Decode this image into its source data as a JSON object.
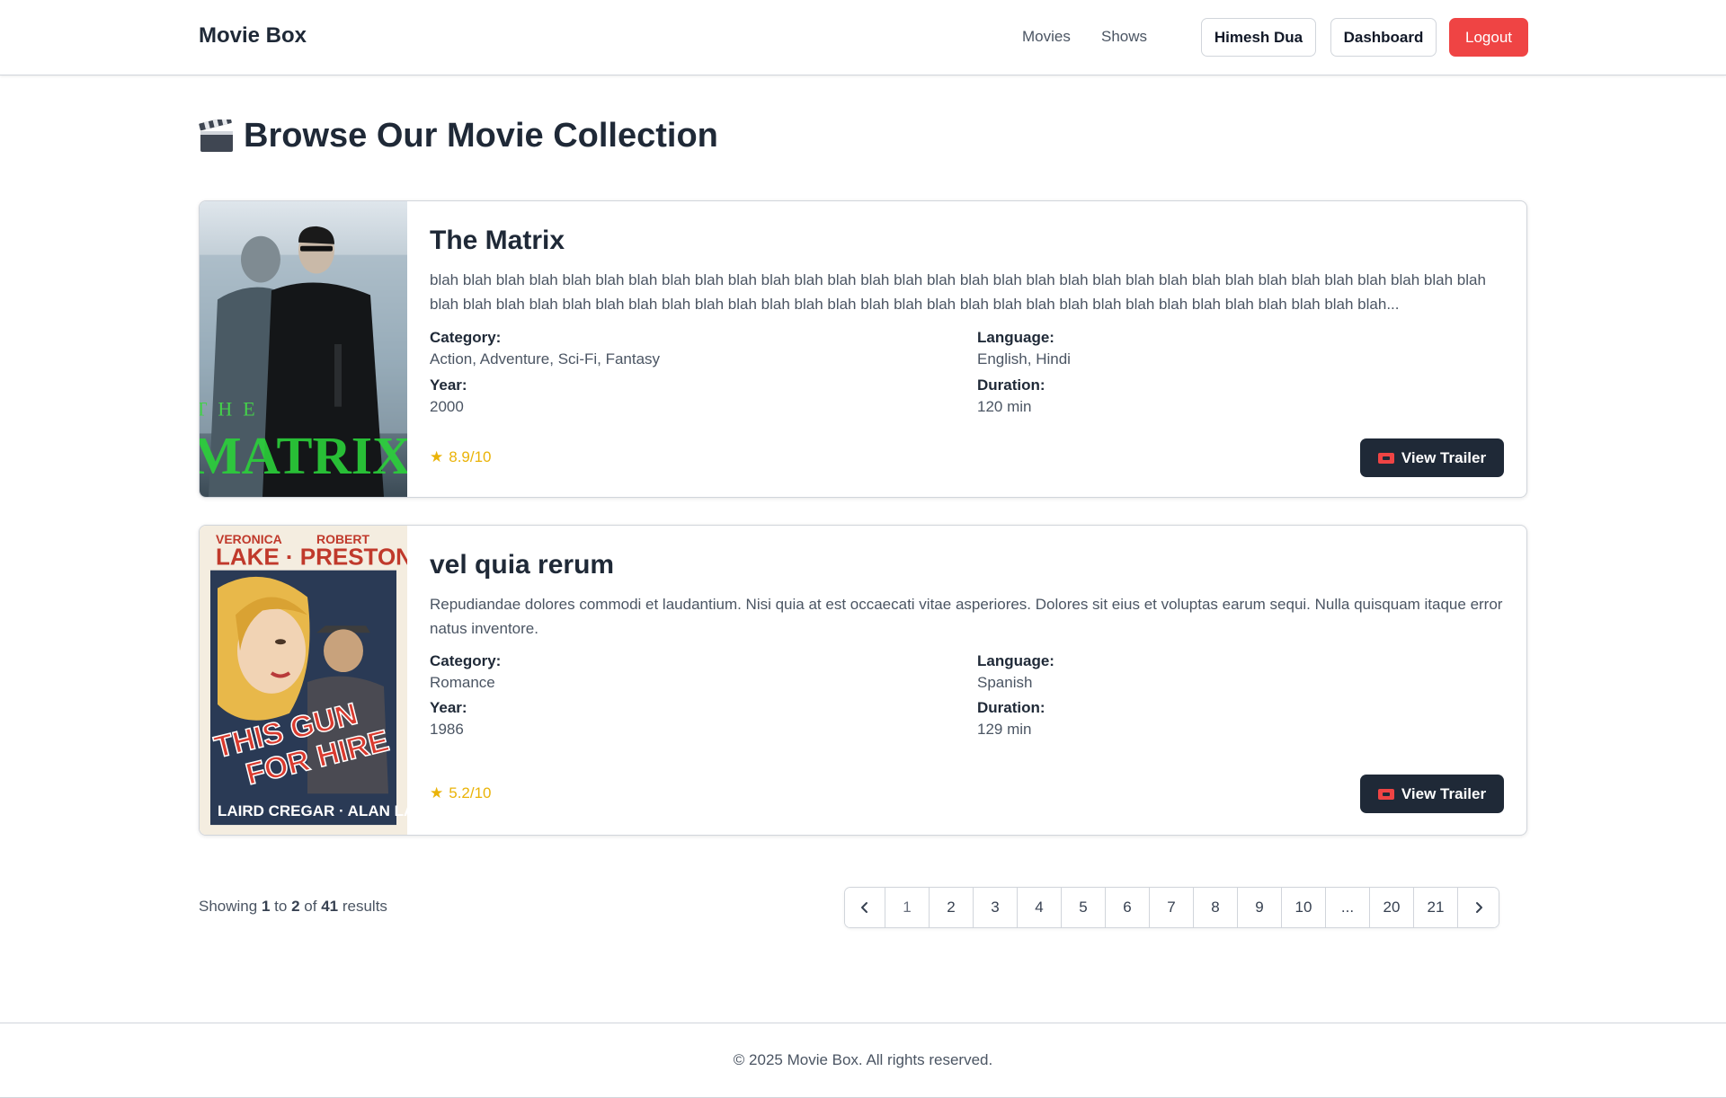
{
  "header": {
    "brand": "Movie Box",
    "nav": [
      "Movies",
      "Shows"
    ],
    "user_label": "Himesh Dua",
    "dashboard_label": "Dashboard",
    "logout_label": "Logout",
    "accent_color": "#ef4444"
  },
  "page": {
    "title": "Browse Our Movie Collection",
    "title_icon": "clapperboard-icon"
  },
  "movies": [
    {
      "title": "The Matrix",
      "description": "blah blah blah blah blah blah blah blah blah blah blah blah blah blah blah blah blah blah blah blah blah blah blah blah blah blah blah blah blah blah blah blah blah blah blah blah blah blah blah blah blah blah blah blah blah blah blah blah blah blah blah blah blah blah blah blah blah blah blah blah blah...",
      "category_label": "Category:",
      "category": "Action, Adventure, Sci-Fi, Fantasy",
      "language_label": "Language:",
      "language": "English, Hindi",
      "year_label": "Year:",
      "year": "2000",
      "duration_label": "Duration:",
      "duration": "120 min",
      "rating": "8.9/10",
      "trailer_label": "View Trailer",
      "poster_text": "THE MATRIX"
    },
    {
      "title": "vel quia rerum",
      "description": "Repudiandae dolores commodi et laudantium. Nisi quia at est occaecati vitae asperiores. Dolores sit eius et voluptas earum sequi. Nulla quisquam itaque error natus inventore.",
      "category_label": "Category:",
      "category": "Romance",
      "language_label": "Language:",
      "language": "Spanish",
      "year_label": "Year:",
      "year": "1986",
      "duration_label": "Duration:",
      "duration": "129 min",
      "rating": "5.2/10",
      "trailer_label": "View Trailer",
      "poster_text": "VERONICA LAKE · ROBERT PRESTON — THIS GUN FOR HIRE — LAIRD CREGAR · ALAN LADD"
    }
  ],
  "results": {
    "prefix": "Showing",
    "from": "1",
    "to_word": "to",
    "to": "2",
    "of_word": "of",
    "total": "41",
    "suffix": "results"
  },
  "pagination": {
    "pages": [
      "1",
      "2",
      "3",
      "4",
      "5",
      "6",
      "7",
      "8",
      "9",
      "10",
      "...",
      "20",
      "21"
    ],
    "current": "1"
  },
  "footer": {
    "copyright": "© 2025 Movie Box. All rights reserved."
  }
}
